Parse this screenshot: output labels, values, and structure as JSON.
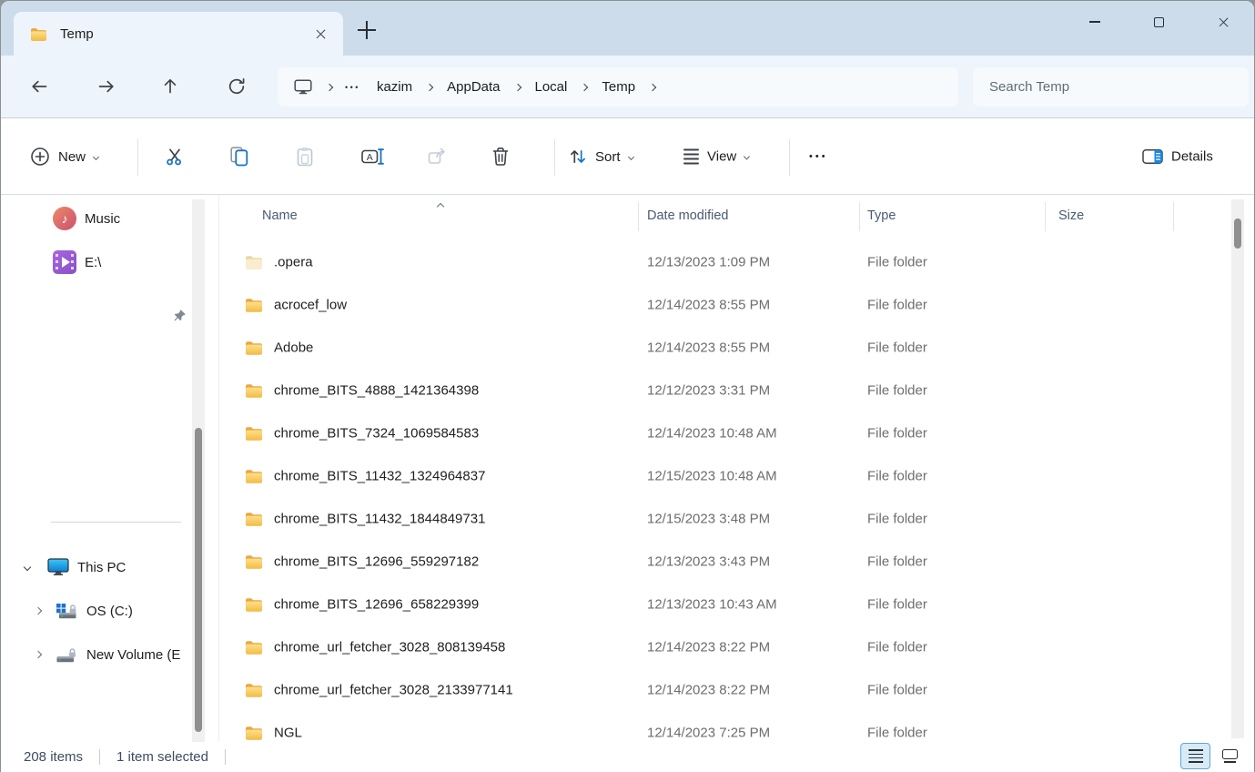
{
  "tab": {
    "title": "Temp"
  },
  "nav": {
    "breadcrumb": {
      "overflow": "•••",
      "crumbs": [
        "kazim",
        "AppData",
        "Local",
        "Temp"
      ]
    },
    "search_placeholder": "Search Temp"
  },
  "toolbar": {
    "new": "New",
    "sort": "Sort",
    "view": "View",
    "more": "•••",
    "details": "Details"
  },
  "sidebar": {
    "pinned": [
      {
        "label": "Music",
        "icon": "music"
      },
      {
        "label": "E:\\",
        "icon": "video-drive"
      },
      {
        "label": "",
        "icon": "none"
      }
    ],
    "tree": [
      {
        "label": "This PC",
        "icon": "this-pc",
        "expanded": true,
        "selected": false
      },
      {
        "label": "OS (C:)",
        "icon": "os-drive",
        "expanded": false,
        "selected": true
      },
      {
        "label": "New Volume (E",
        "icon": "drive",
        "expanded": false,
        "selected": false
      }
    ]
  },
  "list": {
    "columns": [
      "Name",
      "Date modified",
      "Type",
      "Size"
    ],
    "sort": {
      "column": "Name",
      "direction": "ascending"
    },
    "files": [
      {
        "name": ".opera",
        "date": "12/13/2023 1:09 PM",
        "type": "File folder",
        "size": "",
        "icon": "folder-pale"
      },
      {
        "name": "acrocef_low",
        "date": "12/14/2023 8:55 PM",
        "type": "File folder",
        "size": "",
        "icon": "folder"
      },
      {
        "name": "Adobe",
        "date": "12/14/2023 8:55 PM",
        "type": "File folder",
        "size": "",
        "icon": "folder"
      },
      {
        "name": "chrome_BITS_4888_1421364398",
        "date": "12/12/2023 3:31 PM",
        "type": "File folder",
        "size": "",
        "icon": "folder"
      },
      {
        "name": "chrome_BITS_7324_1069584583",
        "date": "12/14/2023 10:48 AM",
        "type": "File folder",
        "size": "",
        "icon": "folder"
      },
      {
        "name": "chrome_BITS_11432_1324964837",
        "date": "12/15/2023 10:48 AM",
        "type": "File folder",
        "size": "",
        "icon": "folder"
      },
      {
        "name": "chrome_BITS_11432_1844849731",
        "date": "12/15/2023 3:48 PM",
        "type": "File folder",
        "size": "",
        "icon": "folder"
      },
      {
        "name": "chrome_BITS_12696_559297182",
        "date": "12/13/2023 3:43 PM",
        "type": "File folder",
        "size": "",
        "icon": "folder"
      },
      {
        "name": "chrome_BITS_12696_658229399",
        "date": "12/13/2023 10:43 AM",
        "type": "File folder",
        "size": "",
        "icon": "folder"
      },
      {
        "name": "chrome_url_fetcher_3028_808139458",
        "date": "12/14/2023 8:22 PM",
        "type": "File folder",
        "size": "",
        "icon": "folder"
      },
      {
        "name": "chrome_url_fetcher_3028_2133977141",
        "date": "12/14/2023 8:22 PM",
        "type": "File folder",
        "size": "",
        "icon": "folder"
      },
      {
        "name": "NGL",
        "date": "12/14/2023 7:25 PM",
        "type": "File folder",
        "size": "",
        "icon": "folder"
      }
    ]
  },
  "status": {
    "items": "208 items",
    "selection": "1 item selected"
  },
  "colors": {
    "accent_blue": "#1474c4",
    "tabstrip": "#ccdcea",
    "surface": "#eef4fb",
    "folder_yellow": "#f2bd43"
  }
}
